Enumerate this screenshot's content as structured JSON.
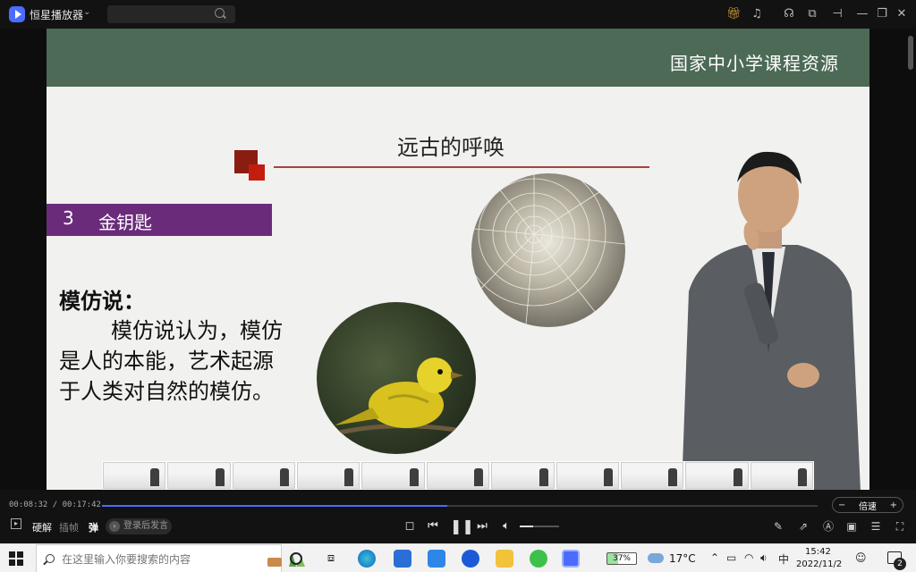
{
  "titlebar": {
    "app_title": "恒星播放器",
    "search_placeholder": ""
  },
  "slide": {
    "brand": "国家中小学课程资源",
    "title": "远古的呼唤",
    "section_number": "3",
    "section_title": "金钥匙",
    "heading": "模仿说：",
    "body_lines": [
      "模仿说认为，模仿",
      "是人的本能，艺术起源",
      "于人类对自然的模仿。"
    ]
  },
  "player": {
    "time_text": "00:08:32 / 00:17:42",
    "progress_fraction": 0.482,
    "speed_label": "倍速",
    "speed_minus": "−",
    "speed_plus": "+",
    "hw_decode_label": "硬解",
    "frame_label": "插帧",
    "danmu_label": "弹",
    "danmu_post_label": "登录后发言",
    "volume_fraction": 0.35
  },
  "taskbar": {
    "search_placeholder": "在这里输入你要搜索的内容",
    "battery": "37%",
    "temperature": "17°C",
    "ime": "中",
    "time": "15:42",
    "date": "2022/11/2",
    "notifications": "2"
  },
  "colors": {
    "accent": "#4b6cff",
    "slide_header": "#4c6a55",
    "banner": "#6a2c7a",
    "rule": "#a4453c"
  }
}
